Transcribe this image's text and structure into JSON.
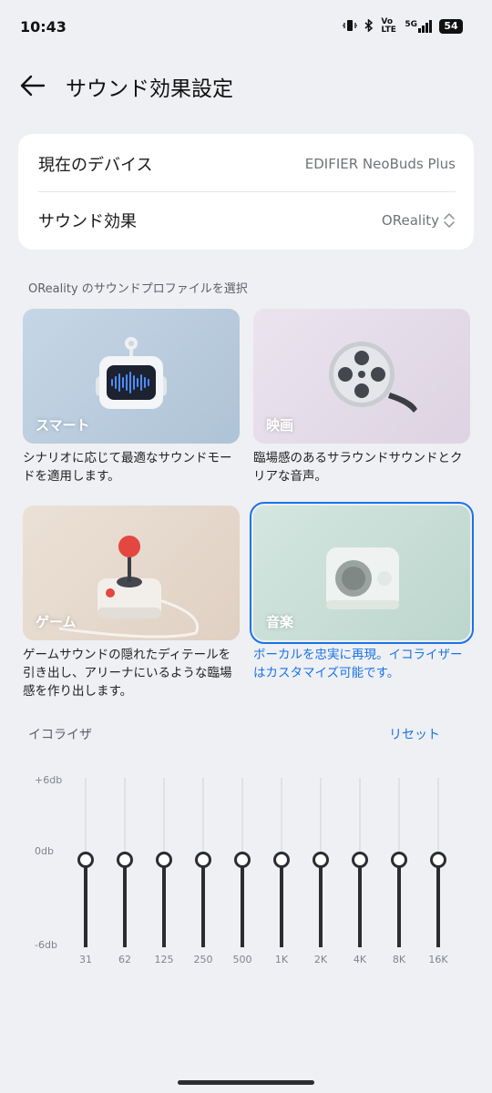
{
  "status": {
    "time": "10:43",
    "volte": "Vo LTE",
    "network": "5G",
    "battery": "54"
  },
  "header": {
    "title": "サウンド効果設定"
  },
  "device_card": {
    "device_label": "現在のデバイス",
    "device_value": "EDIFIER NeoBuds Plus",
    "effect_label": "サウンド効果",
    "effect_value": "OReality"
  },
  "profiles": {
    "section_label": "OReality のサウンドプロファイルを選択",
    "items": [
      {
        "name": "スマート",
        "desc": "シナリオに応じて最適なサウンドモードを適用します。",
        "selected": false
      },
      {
        "name": "映画",
        "desc": "臨場感のあるサラウンドサウンドとクリアな音声。",
        "selected": false
      },
      {
        "name": "ゲーム",
        "desc": "ゲームサウンドの隠れたディテールを引き出し、アリーナにいるような臨場感を作り出します。",
        "selected": false
      },
      {
        "name": "音楽",
        "desc": "ボーカルを忠実に再現。イコライザーはカスタマイズ可能です。",
        "selected": true
      }
    ]
  },
  "equalizer": {
    "label": "イコライザ",
    "reset": "リセット",
    "scale_max": "+6db",
    "scale_mid": "0db",
    "scale_min": "-6db",
    "bands": [
      {
        "freq": "31",
        "gain_db": 0
      },
      {
        "freq": "62",
        "gain_db": 0
      },
      {
        "freq": "125",
        "gain_db": 0
      },
      {
        "freq": "250",
        "gain_db": 0
      },
      {
        "freq": "500",
        "gain_db": 0
      },
      {
        "freq": "1K",
        "gain_db": 0
      },
      {
        "freq": "2K",
        "gain_db": 0
      },
      {
        "freq": "4K",
        "gain_db": 0
      },
      {
        "freq": "8K",
        "gain_db": 0
      },
      {
        "freq": "16K",
        "gain_db": 0
      }
    ]
  },
  "colors": {
    "accent": "#1a73e8",
    "background": "#eef0f3",
    "slider": "#2b2d31"
  }
}
